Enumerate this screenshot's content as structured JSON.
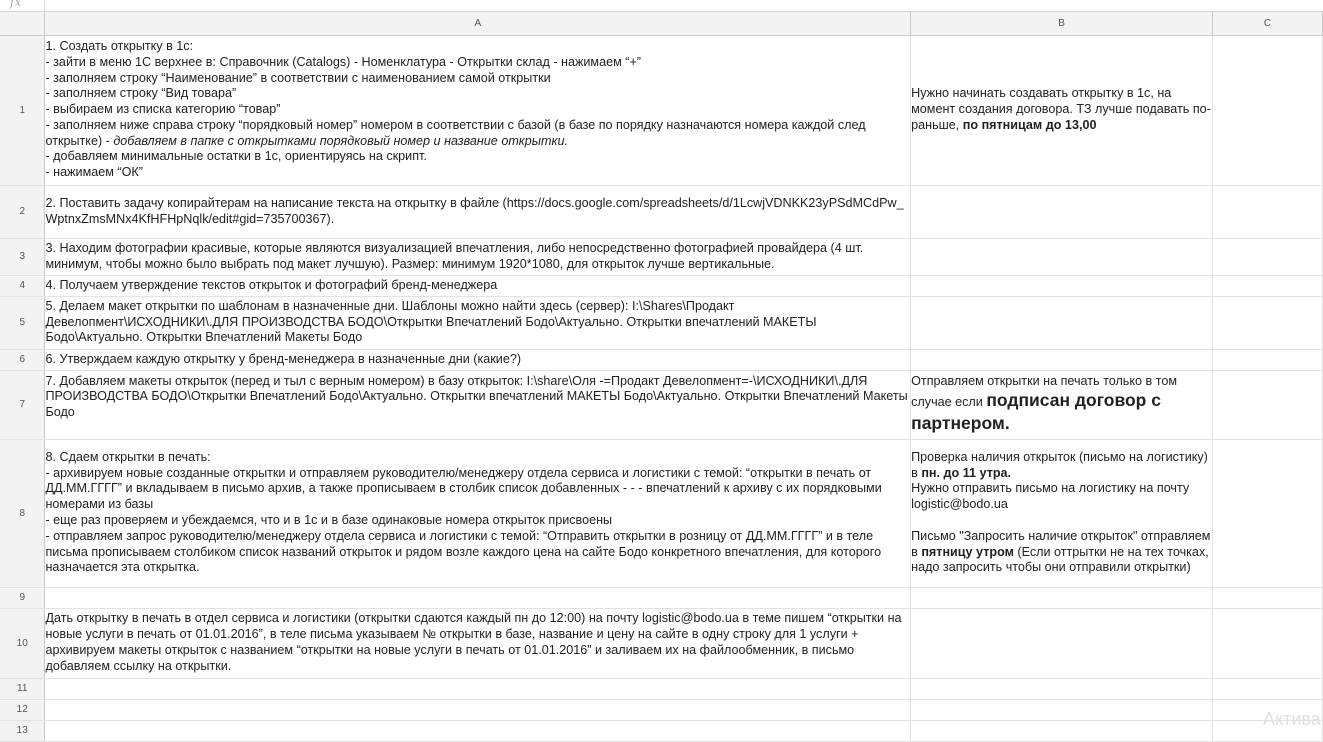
{
  "toolbar": {
    "fx_label": "fx"
  },
  "columns": [
    "A",
    "B",
    "C"
  ],
  "rows": [
    {
      "num": "1",
      "a": [
        "1. Создать открытку в 1с:",
        "- зайти в меню 1С верхнее в: Справочник (Catalogs) - Номенклатура - Открытки склад - нажимаем “+”",
        "- заполняем строку “Наименование” в соответствии с наименованием самой открытки",
        "- заполняем строку “Вид товара”",
        "- выбираем из списка категорию “товар”",
        "- заполняем ниже справа строку “порядковый номер” номером в соответствии с базой (в базе по порядку назначаются номера каждой след открытке) - ",
        "добавляем в папке с открытками порядковый номер и название открытки.",
        "- добавляем минимальные остатки в 1с, ориентируясь на скрипт.",
        "- нажимаем “ОК”"
      ],
      "b_text": "Нужно начинать создавать открытку в 1с, на момент создания договора. ТЗ лучше подавать по-раньше, ",
      "b_bold": "по пятницам до 13,00"
    },
    {
      "num": "2",
      "a": [
        "2. Поставить задачу копирайтерам на написание текста на открытку в файле (https://docs.google.com/spreadsheets/d/1LcwjVDNKK23yPSdMCdPw_WptnxZmsMNx4KfHFHpNqlk/edit#gid=735700367)."
      ]
    },
    {
      "num": "3",
      "a": [
        "3. Находим фотографии красивые, которые являются визуализацией впечатления, либо непосредственно фотографией провайдера (4 шт. минимум, чтобы можно было выбрать под макет лучшую). Размер: минимум 1920*1080, для открыток лучше вертикальные."
      ]
    },
    {
      "num": "4",
      "a": [
        "4. Получаем утверждение текстов открыток и фотографий  бренд-менеджера"
      ]
    },
    {
      "num": "5",
      "a": [
        "5. Делаем макет открытки по шаблонам в назначенные дни. Шаблоны можно найти здесь (сервер): I:\\Shares\\Продакт Девелопмент\\ИСХОДНИКИ\\.ДЛЯ ПРОИЗВОДСТВА БОДО\\Открытки Впечатлений Бодо\\Актуально. Открытки впечатлений МАКЕТЫ Бодо\\Актуально. Открытки Впечатлений Макеты Бодо"
      ]
    },
    {
      "num": "6",
      "a": [
        "6. Утверждаем каждую открытку у бренд-менеджера в назначенные дни (какие?)"
      ]
    },
    {
      "num": "7",
      "a": [
        "7. Добавляем макеты открыток (перед и тыл с верным номером) в базу открыток: I:\\share\\Оля -=Продакт Девелопмент=-\\ИСХОДНИКИ\\.ДЛЯ ПРОИЗВОДСТВА БОДО\\Открытки Впечатлений Бодо\\Актуально. Открытки впечатлений МАКЕТЫ Бодо\\Актуально. Открытки Впечатлений Макеты Бодо"
      ],
      "b_text": "Отправляем открытки на печать только в том случае если ",
      "b_big": "подписан договор с партнером."
    },
    {
      "num": "8",
      "a": [
        "8. Сдаем открытки в печать:",
        "- архивируем новые созданные открытки и отправляем руководителю/менеджеру отдела сервиса и логистики с темой: “открытки в печать от ДД.ММ.ГГГГ” и вкладываем в письмо архив, а также прописываем в столбик список добавленных - - - впечатлений к архиву с их порядковыми номерами из базы",
        "- еще раз проверяем и убеждаемся, что и в 1с и в базе одинаковые номера открыток присвоены",
        "- отправляем запрос руководителю/менеджеру отдела сервиса и логистики с темой: “Отправить открытки в розницу от ДД.ММ.ГГГГ” и в теле письма прописываем столбиком список названий открыток и рядом возле каждого цена на сайте Бодо конкретного впечатления, для которого назначается эта открытка."
      ],
      "b1_text": "Проверка наличия открыток (письмо на логистику) в ",
      "b1_bold": "пн. до 11 утра.",
      "b2_text": "Нужно отправить письмо на логистику на почту logistic@bodo.ua",
      "b3_text": "Письмо \"Запросить наличие открыток\" отправляем в ",
      "b3_bold": "пятницу утром",
      "b3_tail": " (Если оттрытки не на тех точках, надо запросить чтобы они отправили открытки)"
    },
    {
      "num": "9",
      "a": []
    },
    {
      "num": "10",
      "a": [
        "Дать открытку в печать в отдел сервиса и логистики (открытки сдаются каждый пн до 12:00) на почту logistic@bodo.ua в теме пишем “открытки на новые услуги в печать от 01.01.2016”, в теле письма указываем № открытки в базе, название и цену на сайте в одну строку для 1 услуги + архивируем макеты открыток с названием “открытки на новые услуги в печать от 01.01.2016” и заливаем их на файлообменник, в письмо добавляем ссылку на открытки."
      ]
    },
    {
      "num": "11",
      "a": []
    },
    {
      "num": "12",
      "a": []
    },
    {
      "num": "13",
      "a": []
    }
  ],
  "watermark": "Активац"
}
